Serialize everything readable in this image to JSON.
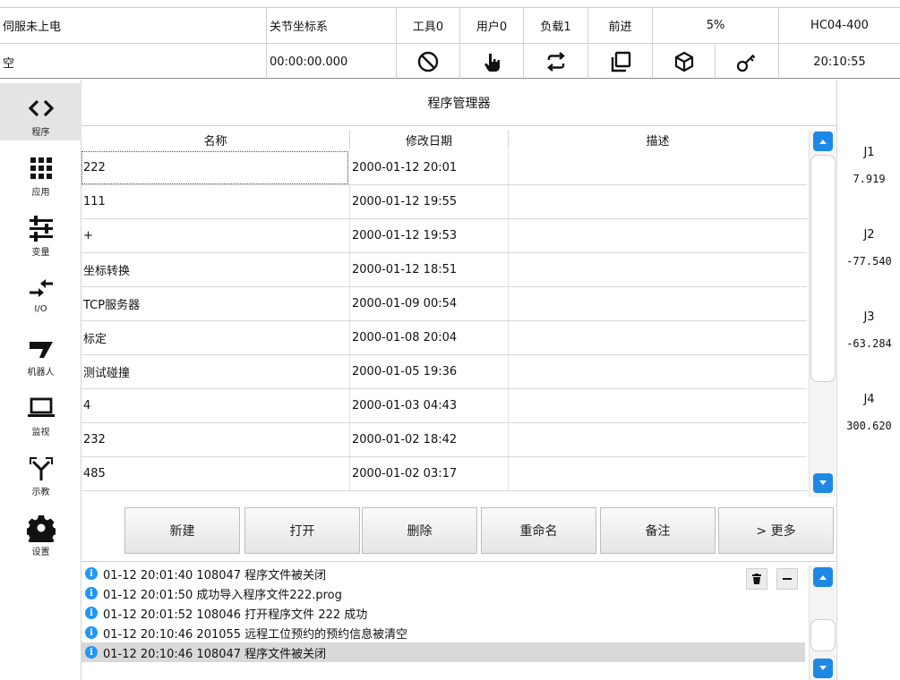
{
  "status": {
    "servo": "伺服未上电",
    "coord": "关节坐标系",
    "tool": "工具0",
    "user": "用户0",
    "load": "负载1",
    "direction": "前进",
    "speed": "5%",
    "model": "HC04-400",
    "program": "空",
    "elapsed": "00:00:00.000",
    "clock": "20:10:55",
    "icons": [
      "prohibit-icon",
      "hand-pointer-icon",
      "cycle-icon",
      "copy-square-icon",
      "cube-icon",
      "key-icon"
    ]
  },
  "sidebar": {
    "items": [
      {
        "label": "程序",
        "icon": "code-brackets-icon",
        "active": true
      },
      {
        "label": "应用",
        "icon": "grid-icon"
      },
      {
        "label": "变量",
        "icon": "sliders-icon"
      },
      {
        "label": "I/O",
        "icon": "io-arrows-icon"
      },
      {
        "label": "机器人",
        "icon": "robot-arm-icon"
      },
      {
        "label": "监视",
        "icon": "laptop-icon"
      },
      {
        "label": "示教",
        "icon": "teach-icon"
      },
      {
        "label": "设置",
        "icon": "gear-icon"
      }
    ]
  },
  "main": {
    "title": "程序管理器",
    "columns": [
      "名称",
      "修改日期",
      "描述"
    ],
    "rows": [
      {
        "name": "222",
        "date": "2000-01-12 20:01",
        "desc": ""
      },
      {
        "name": "111",
        "date": "2000-01-12 19:55",
        "desc": ""
      },
      {
        "name": "+",
        "date": "2000-01-12 19:53",
        "desc": ""
      },
      {
        "name": "坐标转换",
        "date": "2000-01-12 18:51",
        "desc": ""
      },
      {
        "name": "TCP服务器",
        "date": "2000-01-09 00:54",
        "desc": ""
      },
      {
        "name": "标定",
        "date": "2000-01-08 20:04",
        "desc": ""
      },
      {
        "name": "测试碰撞",
        "date": "2000-01-05 19:36",
        "desc": ""
      },
      {
        "name": "4",
        "date": "2000-01-03 04:43",
        "desc": ""
      },
      {
        "name": "232",
        "date": "2000-01-02 18:42",
        "desc": ""
      },
      {
        "name": "485",
        "date": "2000-01-02 03:17",
        "desc": ""
      }
    ],
    "buttons": [
      "新建",
      "打开",
      "删除",
      "重命名",
      "备注",
      "> 更多"
    ]
  },
  "log": {
    "lines": [
      "01-12 20:01:40 108047 程序文件被关闭",
      "01-12 20:01:50 成功导入程序文件222.prog",
      "01-12 20:01:52 108046 打开程序文件 222 成功",
      "01-12 20:10:46 201055 远程工位预约的预约信息被清空",
      "01-12 20:10:46 108047 程序文件被关闭"
    ],
    "info_glyph": "i",
    "delete_icon": "trash-icon",
    "minimize_icon": "minus-icon"
  },
  "joints": [
    {
      "name": "J1",
      "value": "7.919"
    },
    {
      "name": "J2",
      "value": "-77.540"
    },
    {
      "name": "J3",
      "value": "-63.284"
    },
    {
      "name": "J4",
      "value": "300.620"
    }
  ],
  "colors": {
    "accent": "#1e88e5",
    "info": "#2196f3"
  }
}
